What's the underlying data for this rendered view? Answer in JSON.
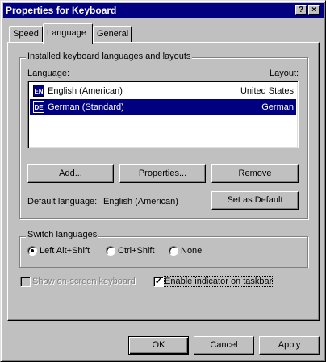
{
  "window": {
    "title": "Properties for Keyboard",
    "help_button": "?",
    "close_button": "×"
  },
  "tabs": [
    {
      "label": "Speed"
    },
    {
      "label": "Language"
    },
    {
      "label": "General"
    }
  ],
  "languages_group": {
    "title": "Installed keyboard languages and layouts",
    "col_language": "Language:",
    "col_layout": "Layout:",
    "rows": [
      {
        "flag": "EN",
        "language": "English (American)",
        "layout": "United States",
        "selected": false
      },
      {
        "flag": "DE",
        "language": "German (Standard)",
        "layout": "German",
        "selected": true
      }
    ],
    "buttons": {
      "add": "Add...",
      "properties": "Properties...",
      "remove": "Remove"
    },
    "default_label": "Default language:",
    "default_value": "English (American)",
    "set_default": "Set as Default"
  },
  "switch_group": {
    "title": "Switch languages",
    "options": [
      {
        "label": "Left Alt+Shift",
        "checked": true
      },
      {
        "label": "Ctrl+Shift",
        "checked": false
      },
      {
        "label": "None",
        "checked": false
      }
    ]
  },
  "checkboxes": {
    "onscreen": {
      "label": "Show on-screen keyboard",
      "checked": false,
      "enabled": false
    },
    "indicator": {
      "label": "Enable indicator on taskbar",
      "checked": true,
      "enabled": true
    }
  },
  "footer": {
    "ok": "OK",
    "cancel": "Cancel",
    "apply": "Apply"
  }
}
